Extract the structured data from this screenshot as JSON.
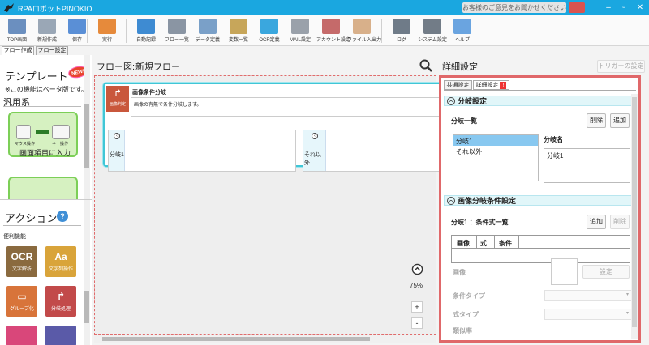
{
  "app": {
    "title": "RPAロボットPINOKIO",
    "feedback": "お客様のご意見をお聞かせください"
  },
  "toolbar": [
    {
      "label": "TOP画面",
      "color": "#6b8fbf"
    },
    {
      "label": "新規作成",
      "color": "#9aa7b6"
    },
    {
      "label": "保存",
      "color": "#5a8fd6"
    },
    {
      "label": "実行",
      "color": "#e68a3b"
    },
    {
      "label": "自動記録",
      "color": "#3e8bd2"
    },
    {
      "label": "フロー一覧",
      "color": "#8a95a3"
    },
    {
      "label": "データ定義",
      "color": "#7aa0c8"
    },
    {
      "label": "変数一覧",
      "color": "#c7a65a"
    },
    {
      "label": "OCR定義",
      "color": "#3aa7de"
    },
    {
      "label": "MAIL設定",
      "color": "#9aa1aa"
    },
    {
      "label": "アカウント設定",
      "color": "#c56a6a"
    },
    {
      "label": "ファイル入出力",
      "color": "#d8b08a"
    },
    {
      "label": "ログ",
      "color": "#6f7b88"
    },
    {
      "label": "システム設定",
      "color": "#727c87"
    },
    {
      "label": "ヘルプ",
      "color": "#6aa4e0"
    }
  ],
  "left": {
    "tabs": [
      "フロー作成",
      "フロー設定"
    ],
    "template": {
      "title": "テンプレート",
      "new_badge": "NEW!",
      "note": "※この機能はベータ版です。",
      "category": "汎用系",
      "card1": "画面項目に入力",
      "card1_left": "マウス操作",
      "card1_right": "キー操作"
    },
    "action": {
      "title": "アクション",
      "help": "?",
      "category": "便利機能",
      "tiles": [
        {
          "glyph": "OCR",
          "label": "文字解析",
          "color": "#8a6a3f"
        },
        {
          "glyph": "Aa",
          "label": "文字列操作",
          "color": "#d9a43a"
        },
        {
          "glyph": "▭",
          "label": "グループ化",
          "color": "#d8743a"
        },
        {
          "glyph": "↱",
          "label": "分岐処理",
          "color": "#c24a4a"
        }
      ]
    }
  },
  "flow": {
    "label": "フロー図:",
    "name": "新規フロー",
    "zoom": "75%",
    "zoom_in": "+",
    "zoom_out": "-",
    "node": {
      "title": "画像条件分岐",
      "desc": "画像の有無で条件分岐します。",
      "icon_caption": "画像判定",
      "branch1": "分岐1",
      "branch2": "それ以外"
    }
  },
  "detail": {
    "title": "詳細設定",
    "trigger_button": "トリガーの設定",
    "tabs": [
      "共通設定",
      "詳細設定"
    ],
    "branch": {
      "header": "分岐設定",
      "list_label": "分岐一覧",
      "delete": "削除",
      "add": "追加",
      "items": [
        "分岐1",
        "それ以外"
      ],
      "name_label": "分岐名",
      "name_value": "分岐1"
    },
    "image_cond": {
      "header": "画像分岐条件設定",
      "subtitle": "分岐1 ：条件式一覧",
      "add": "追加",
      "delete": "削除",
      "columns": [
        "画像",
        "式",
        "条件"
      ],
      "image_label": "画像",
      "setting_button": "設定",
      "cond_type": "条件タイプ",
      "expr_type": "式タイプ",
      "similarity": "類似率"
    }
  }
}
